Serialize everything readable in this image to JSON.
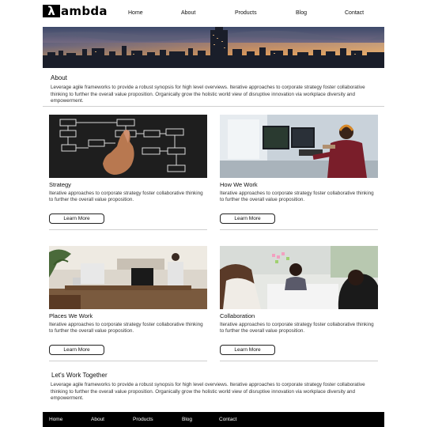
{
  "brand": {
    "mark": "λ",
    "name": "ambda"
  },
  "nav": [
    "Home",
    "About",
    "Products",
    "Blog",
    "Contact"
  ],
  "about": {
    "title": "About",
    "text": "Leverage agile frameworks to provide a robust synopsis for high level overviews. Iterative approaches to corporate strategy foster collaborative thinking to further the overall value proposition. Organically grow the holistic world view of disruptive innovation via workplace diversity and empowerment."
  },
  "cards": [
    {
      "title": "Strategy",
      "text": "Iterative approaches to corporate strategy foster collaborative thinking to further the overall value proposition.",
      "button": "Learn More"
    },
    {
      "title": "How We Work",
      "text": "Iterative approaches to corporate strategy foster collaborative thinking to further the overall value proposition.",
      "button": "Learn More"
    },
    {
      "title": "Places We Work",
      "text": "Iterative approaches to corporate strategy foster collaborative thinking to further the overall value proposition.",
      "button": "Learn More"
    },
    {
      "title": "Collaboration",
      "text": "Iterative approaches to corporate strategy foster collaborative thinking to further the overall value proposition.",
      "button": "Learn More"
    }
  ],
  "together": {
    "title": "Let's Work Together",
    "text": "Leverage agile frameworks to provide a robust synopsis for high level overviews. Iterative approaches to corporate strategy foster collaborative thinking to further the overall value proposition. Organically grow the holistic world view of disruptive innovation via workplace diversity and empowerment."
  },
  "footer_nav": [
    "Home",
    "About",
    "Products",
    "Blog",
    "Contact"
  ],
  "colors": {
    "footer_bg": "#000000",
    "text": "#222222",
    "divider": "#cfcfcf"
  }
}
